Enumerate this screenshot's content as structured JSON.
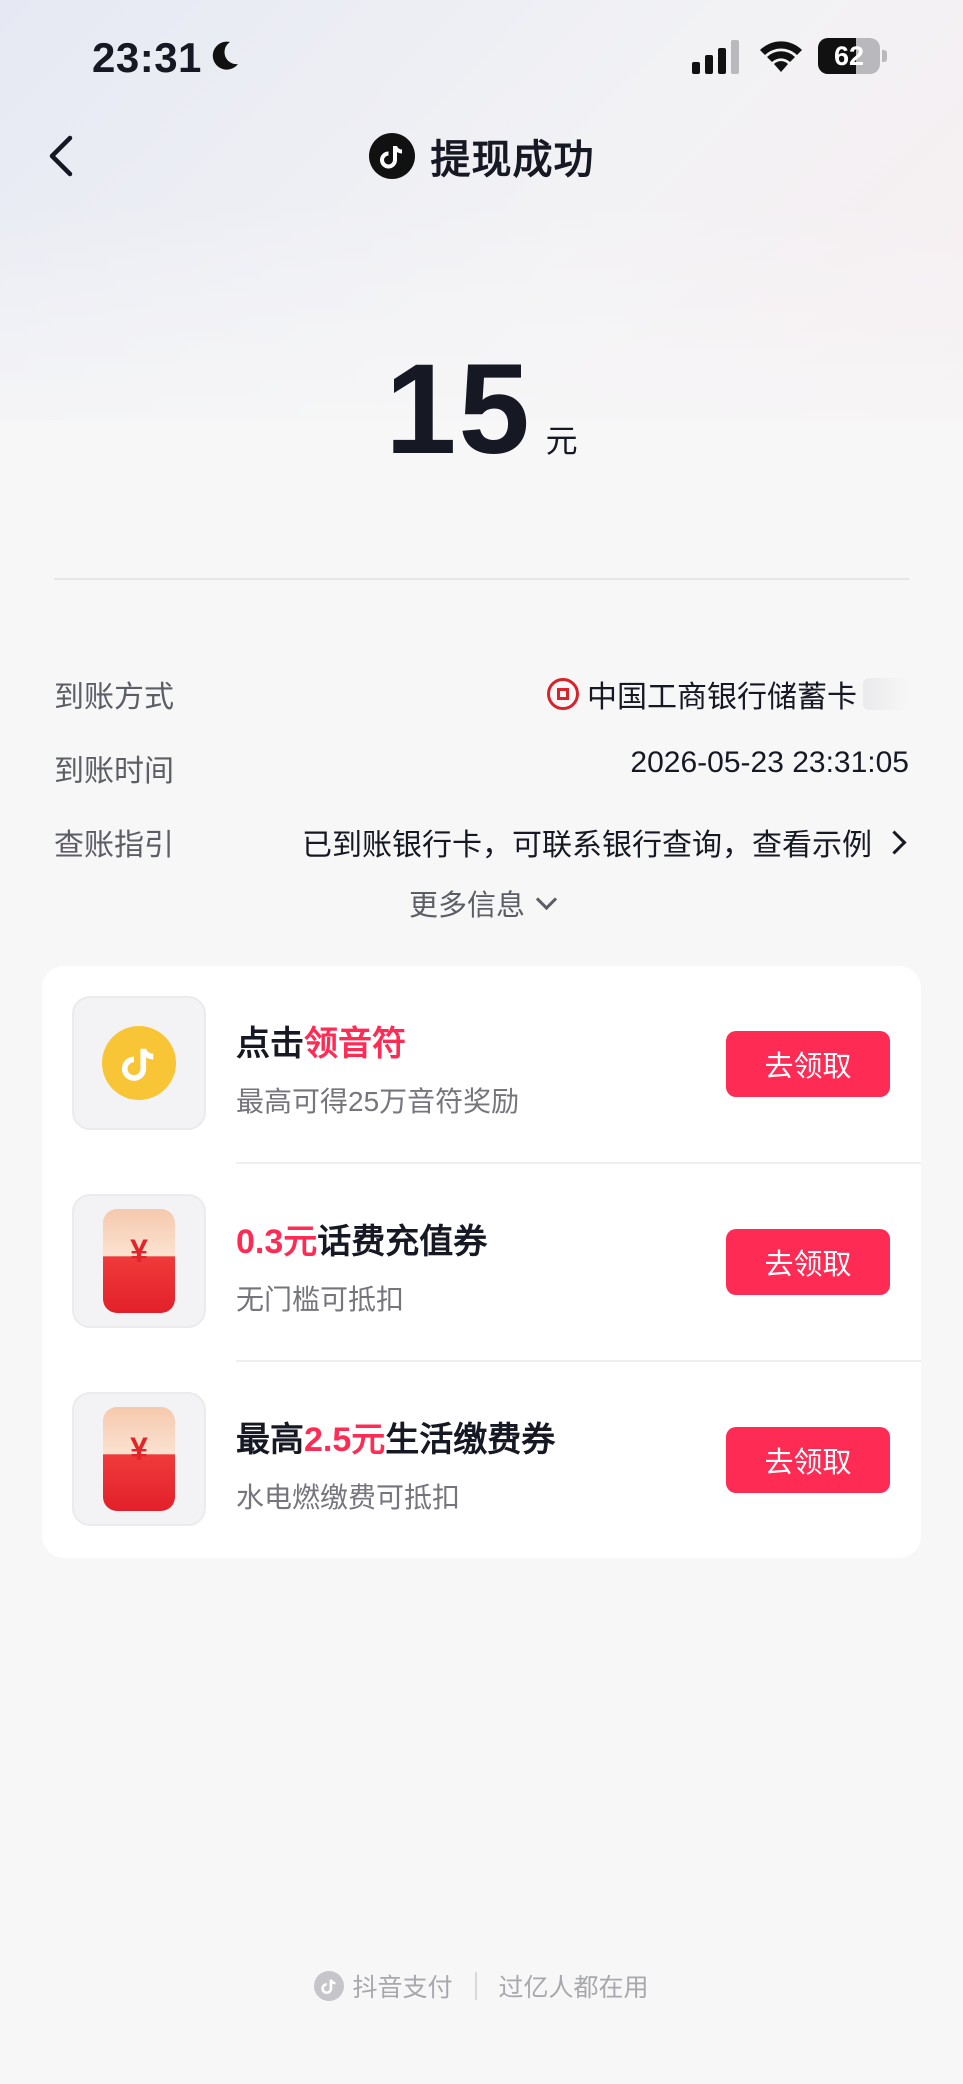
{
  "status_bar": {
    "time": "23:31",
    "battery_percent": "62",
    "battery_level": 0.62,
    "icons": [
      "moon-icon",
      "cellular-signal-icon",
      "wifi-icon",
      "battery-icon"
    ]
  },
  "nav": {
    "title": "提现成功",
    "back_icon": "chevron-left-icon",
    "logo_icon": "douyin-logo-icon"
  },
  "amount": {
    "value": "15",
    "unit": "元"
  },
  "details": [
    {
      "label": "到账方式",
      "value": "中国工商银行储蓄卡",
      "icon": "icbc-bank-icon"
    },
    {
      "label": "到账时间",
      "value": "2026-05-23 23:31:05"
    },
    {
      "label": "查账指引",
      "value": "已到账银行卡，可联系银行查询，查看示例",
      "icon": "chevron-right-icon"
    }
  ],
  "more_info": {
    "label": "更多信息",
    "icon": "chevron-down-icon"
  },
  "rewards": [
    {
      "title_prefix": "点击",
      "title_highlight": "领音符",
      "title_suffix": "",
      "subtitle": "最高可得25万音符奖励",
      "button": "去领取",
      "icon": "music-note-coin-icon"
    },
    {
      "title_prefix": "",
      "title_highlight": "0.3元",
      "title_suffix": "话费充值券",
      "subtitle": "无门槛可抵扣",
      "button": "去领取",
      "icon": "red-envelope-icon",
      "icon_text": "¥"
    },
    {
      "title_prefix": "最高",
      "title_highlight": "2.5元",
      "title_suffix": "生活缴费券",
      "subtitle": "水电燃缴费可抵扣",
      "button": "去领取",
      "icon": "red-envelope-icon",
      "icon_text": "¥"
    }
  ],
  "footer": {
    "brand": "抖音支付",
    "slogan": "过亿人都在用",
    "icon": "douyin-logo-icon"
  },
  "colors": {
    "accent": "#fe2c55",
    "text_primary": "#161823",
    "text_secondary": "#5c5e66",
    "coin_yellow": "#f7c536",
    "bank_red": "#d8232a"
  }
}
